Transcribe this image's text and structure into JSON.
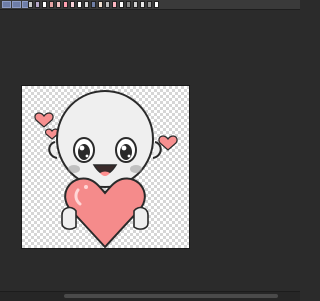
{
  "toolbar": {
    "tools": [
      {
        "name": "brush-tool-icon"
      },
      {
        "name": "pen-tool-icon"
      },
      {
        "name": "select-tool-icon"
      }
    ]
  },
  "palette": {
    "swatches": [
      "#c9c9c9",
      "#b8a9c9",
      "#ffffff",
      "#e6a3a3",
      "#f2c1c1",
      "#ff9fb0",
      "#f7d2d9",
      "#ffffff",
      "#d9d9d9",
      "#6f7fa6",
      "#f0e0d0",
      "#bdbdbd",
      "#ffb6c1",
      "#ffffff",
      "#8a8a8a",
      "#d0d0d0",
      "#e8e8e8",
      "#9a9a9a",
      "#ffffff"
    ]
  },
  "canvas": {
    "artwork_name": "chibi-character-holding-heart",
    "colors": {
      "skin": "#efefef",
      "outline": "#2a2a2a",
      "heart": "#f58b8b",
      "heart_light": "#ffd6d6",
      "blush": "#9b9b9b",
      "mouth": "#3a2a2a",
      "tongue": "#ff8f8f",
      "small_heart": "#f79090"
    }
  },
  "scroll": {
    "horizontal_position": 0.25
  }
}
